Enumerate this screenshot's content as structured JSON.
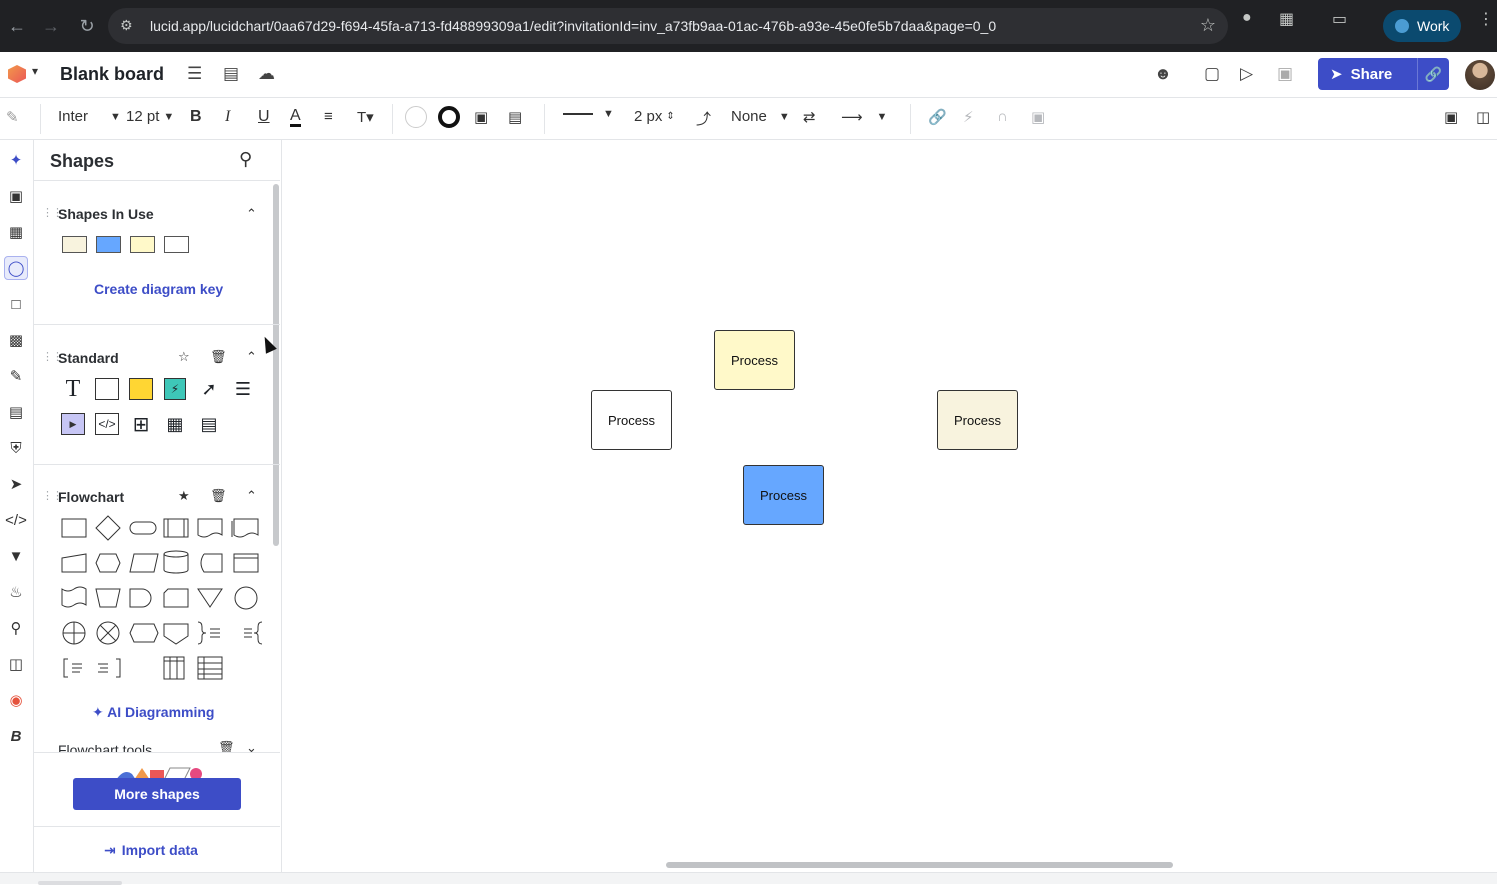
{
  "browser": {
    "url": "lucid.app/lucidchart/0aa67d29-f694-45fa-a713-fd48899309a1/edit?invitationId=inv_a73fb9aa-01ac-476b-a93e-45e0fe5b7daa&page=0_0",
    "profile_label": "Work"
  },
  "header": {
    "title": "Blank board",
    "share_label": "Share"
  },
  "toolbar": {
    "font_family": "Inter",
    "font_size": "12 pt",
    "line_width": "2 px",
    "endpoint": "None",
    "bold": "B",
    "italic": "I",
    "underline": "U",
    "text_color": "A"
  },
  "panel": {
    "title": "Shapes",
    "sections": {
      "in_use": {
        "title": "Shapes In Use",
        "link": "Create diagram key"
      },
      "standard": {
        "title": "Standard"
      },
      "flowchart": {
        "title": "Flowchart",
        "link": "AI Diagramming"
      },
      "flowchart_tools": {
        "title": "Flowchart tools"
      }
    },
    "more_shapes": "More shapes",
    "import_data": "Import data"
  },
  "canvas": {
    "shapes": [
      {
        "label": "Process",
        "fill": "#fff9c9"
      },
      {
        "label": "Process",
        "fill": "#ffffff"
      },
      {
        "label": "Process",
        "fill": "#f8f3de"
      },
      {
        "label": "Process",
        "fill": "#66a7ff"
      }
    ]
  },
  "colors": {
    "accent": "#3d4dc7",
    "swatch_cream": "#f8f3de",
    "swatch_blue": "#66a7ff",
    "swatch_yellow": "#fff9c9",
    "swatch_white": "#ffffff"
  }
}
